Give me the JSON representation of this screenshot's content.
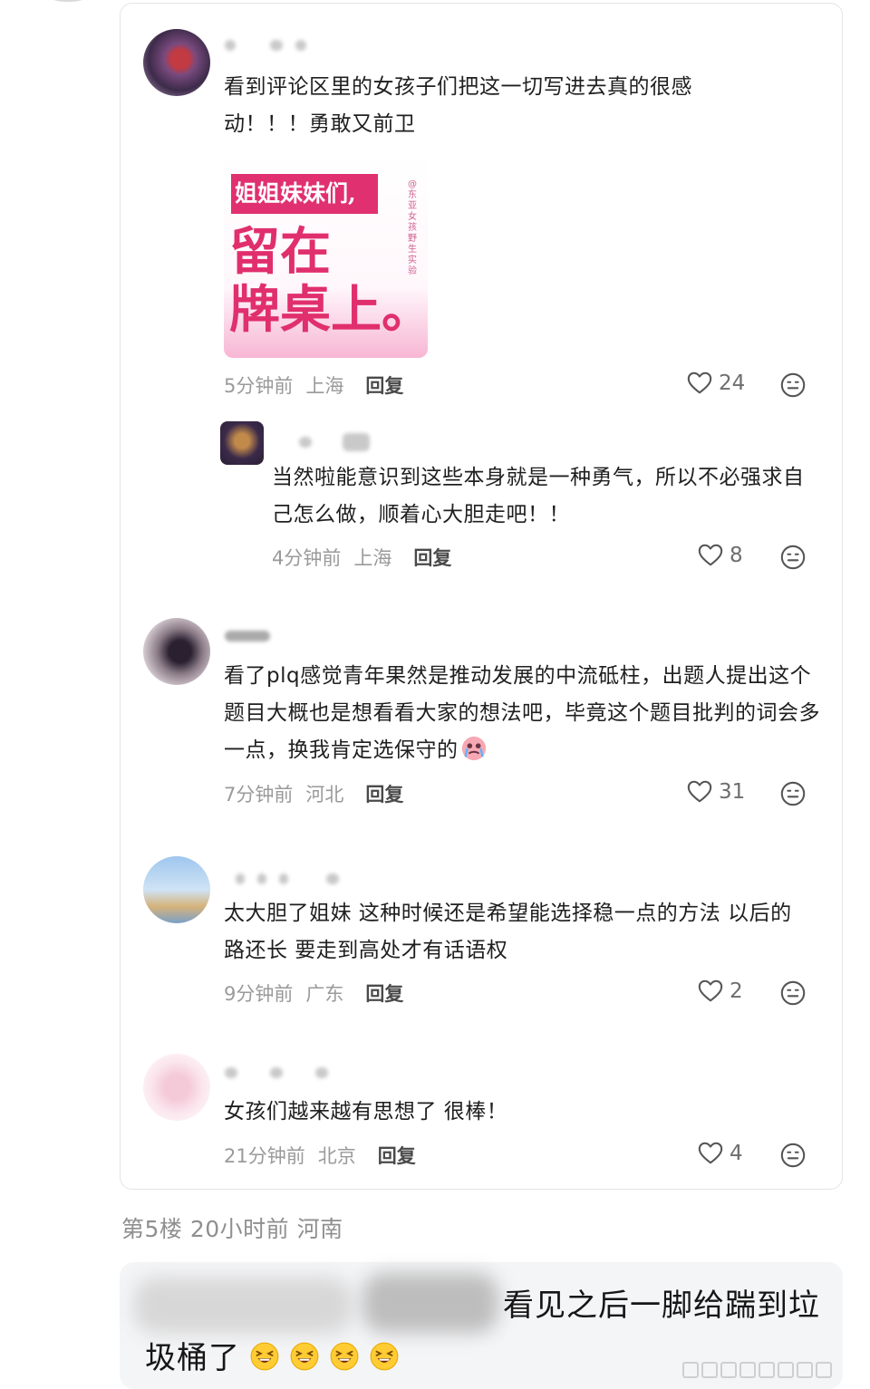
{
  "comments": [
    {
      "text": "看到评论区里的女孩子们把这一切写进去真的很感动！！！勇敢又前卫",
      "time": "5分钟前",
      "location": "上海",
      "reply_label": "回复",
      "likes": "24",
      "image": {
        "band_text": "姐姐妹妹们,",
        "line1": "留在",
        "line2": "牌桌上。",
        "side_text": "@东亚女孩野生实验"
      }
    },
    {
      "text": "当然啦能意识到这些本身就是一种勇气，所以不必强求自己怎么做，顺着心大胆走吧！！",
      "time": "4分钟前",
      "location": "上海",
      "reply_label": "回复",
      "likes": "8"
    },
    {
      "text": "看了plq感觉青年果然是推动发展的中流砥柱，出题人提出这个题目大概也是想看看大家的想法吧，毕竟这个题目批判的词会多一点，换我肯定选保守的",
      "time": "7分钟前",
      "location": "河北",
      "reply_label": "回复",
      "likes": "31"
    },
    {
      "text": "太大胆了姐妹 这种时候还是希望能选择稳一点的方法 以后的路还长 要走到高处才有话语权",
      "time": "9分钟前",
      "location": "广东",
      "reply_label": "回复",
      "likes": "2"
    },
    {
      "text": "女孩们越来越有思想了 很棒！",
      "time": "21分钟前",
      "location": "北京",
      "reply_label": "回复",
      "likes": "4"
    }
  ],
  "floor": {
    "label": "第5楼 20小时前 河南"
  },
  "post": {
    "text": "看见之后一脚给踹到垃圾桶了"
  },
  "icons": {
    "like": "heart-icon",
    "emoji": "emoji-face-icon",
    "grin": "grinning-squint-emoji-icon",
    "crying": "crying-emoji-icon"
  },
  "colors": {
    "accent_pink": "#e0306f",
    "meta_gray": "#9a9a9a"
  }
}
